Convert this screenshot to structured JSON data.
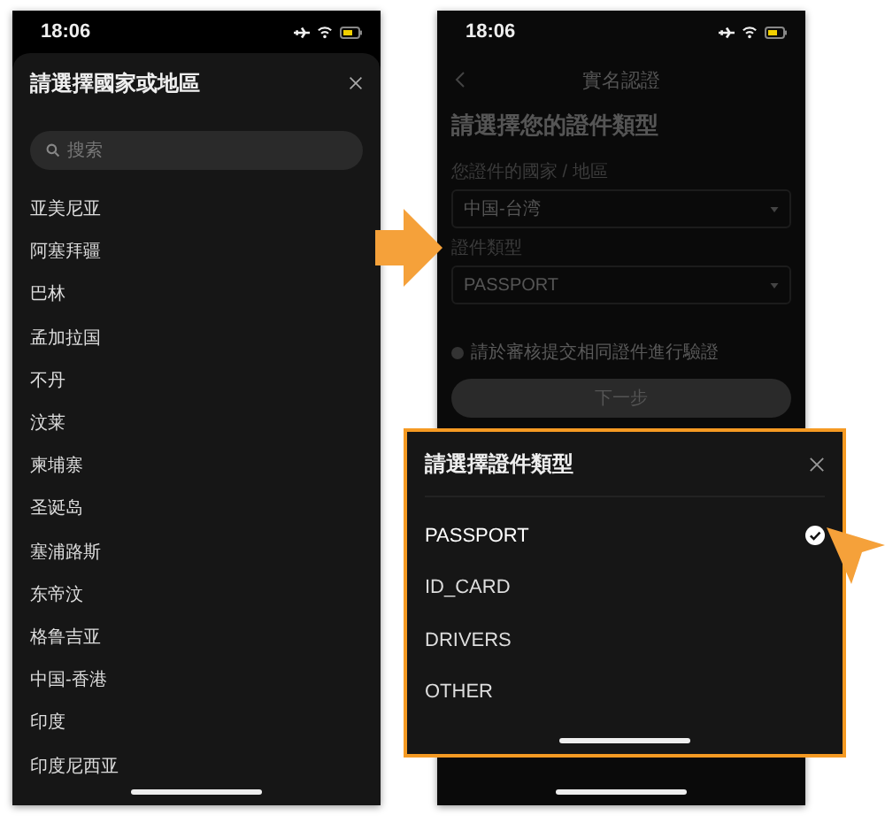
{
  "country_screen": {
    "status_time": "18:06",
    "title": "請選擇國家或地區",
    "search": {
      "placeholder": "搜索"
    },
    "countries": [
      "亚美尼亚",
      "阿塞拜疆",
      "巴林",
      "孟加拉国",
      "不丹",
      "汶莱",
      "柬埔寨",
      "圣诞岛",
      "塞浦路斯",
      "东帝汶",
      "格鲁吉亚",
      "中国-香港",
      "印度",
      "印度尼西亚"
    ]
  },
  "verify_screen": {
    "status_time": "18:06",
    "title": "實名認證",
    "heading": "請選擇您的證件類型",
    "fields": [
      {
        "label": "您證件的國家 / 地區",
        "value": "中国-台湾"
      },
      {
        "label": "證件類型",
        "value": "PASSPORT"
      }
    ],
    "note": "請於審核提交相同證件進行驗證",
    "next_button": "下一步"
  },
  "type_sheet": {
    "title": "請選擇證件類型",
    "options": [
      {
        "label": "PASSPORT",
        "selected": true
      },
      {
        "label": "ID_CARD",
        "selected": false
      },
      {
        "label": "DRIVERS",
        "selected": false
      },
      {
        "label": "OTHER",
        "selected": false
      }
    ]
  }
}
